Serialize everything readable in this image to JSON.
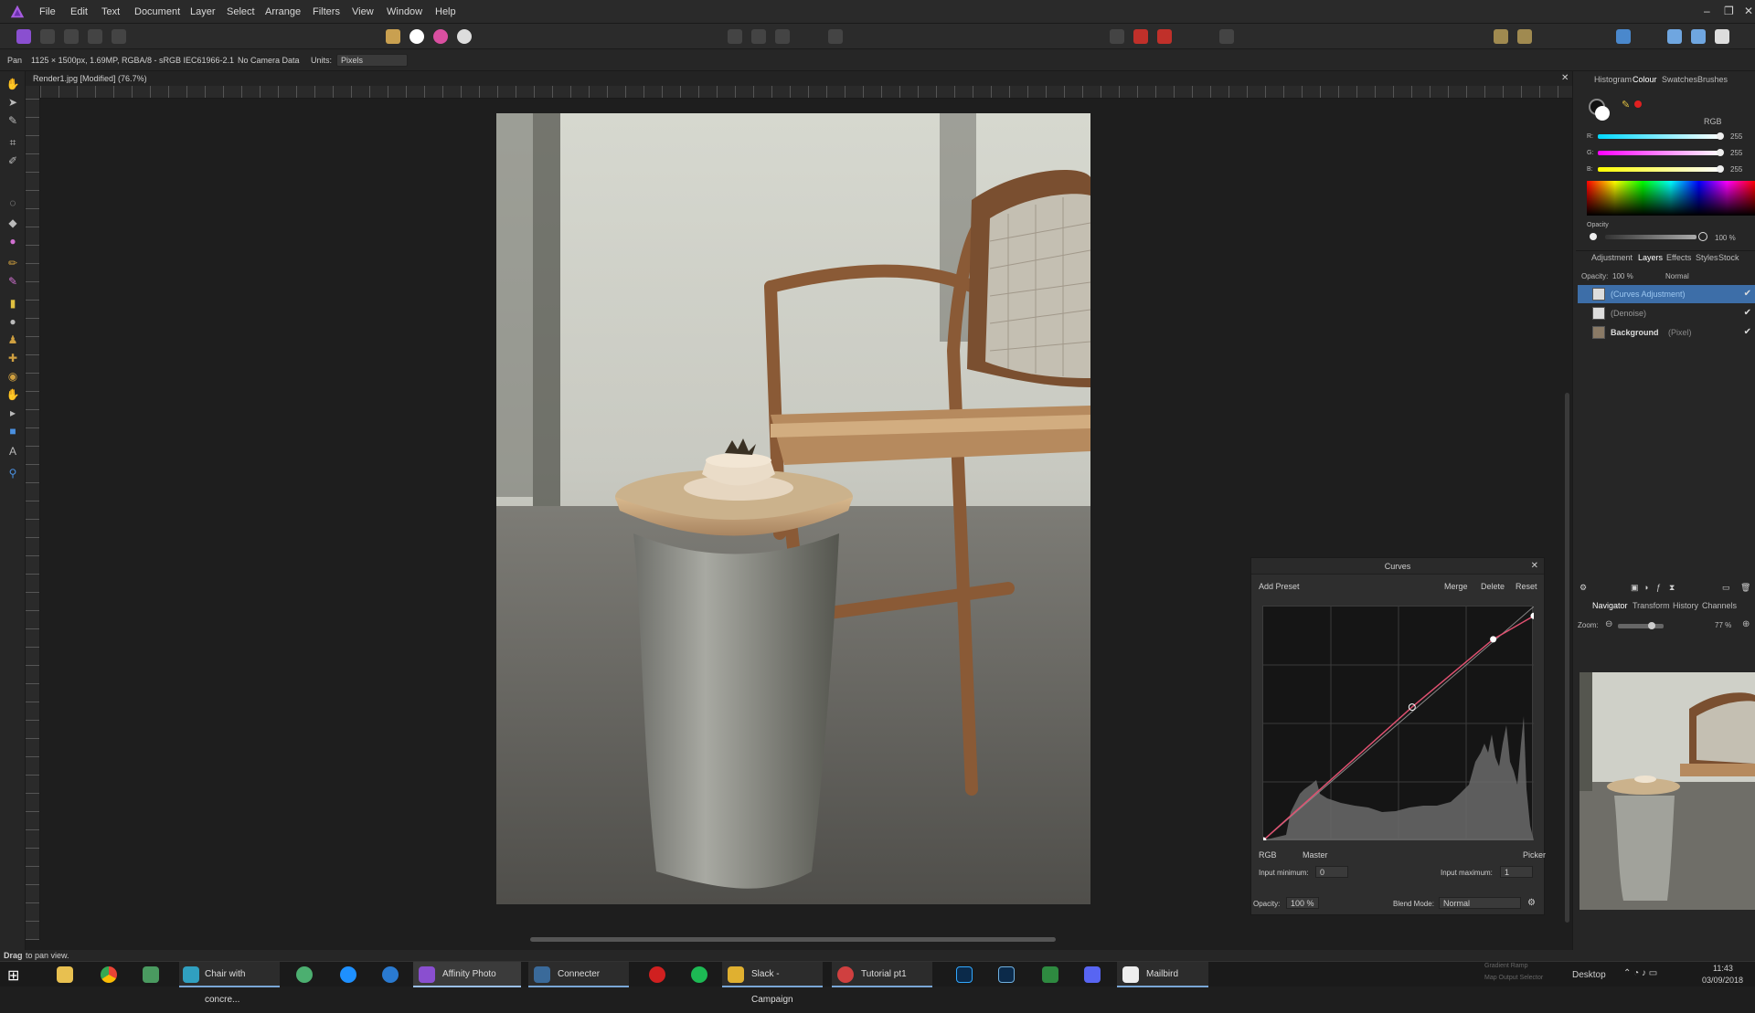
{
  "app": {
    "menu": [
      "File",
      "Edit",
      "Text",
      "Document",
      "Layer",
      "Select",
      "Arrange",
      "Filters",
      "View",
      "Window",
      "Help"
    ],
    "window_controls": [
      "–",
      "❐",
      "✕"
    ]
  },
  "context_bar": {
    "tool": "Pan",
    "image_info": "1125 × 1500px, 1.69MP, RGBA/8 - sRGB IEC61966-2.1",
    "camera": "No Camera Data",
    "units_label": "Units:",
    "units_value": "Pixels"
  },
  "document": {
    "tab_title": "Render1.jpg [Modified] (76.7%)"
  },
  "color_panel": {
    "tabs": [
      "Histogram",
      "Colour",
      "Swatches",
      "Brushes"
    ],
    "active_tab": "Colour",
    "model": "RGB",
    "r_label": "R:",
    "r_value": "255",
    "g_label": "G:",
    "g_value": "255",
    "b_label": "B:",
    "b_value": "255",
    "opacity_label": "Opacity",
    "opacity_value": "100 %"
  },
  "layers_panel": {
    "tabs": [
      "Adjustment",
      "Layers",
      "Effects",
      "Styles",
      "Stock"
    ],
    "active_tab": "Layers",
    "opacity_label": "Opacity:",
    "opacity_value": "100 %",
    "blend": "Normal",
    "layers": [
      {
        "name": "(Curves Adjustment)",
        "selected": true
      },
      {
        "name": "(Denoise)",
        "selected": false
      },
      {
        "name": "Background",
        "suffix": "(Pixel)",
        "selected": false
      }
    ]
  },
  "navigator_panel": {
    "tabs": [
      "Navigator",
      "Transform",
      "History",
      "Channels"
    ],
    "active_tab": "Navigator",
    "zoom_label": "Zoom:",
    "zoom_value": "77 %"
  },
  "curves": {
    "title": "Curves",
    "add_preset": "Add Preset",
    "merge": "Merge",
    "delete": "Delete",
    "reset": "Reset",
    "model": "RGB",
    "channel": "Master",
    "picker": "Picker",
    "input_min_label": "Input minimum:",
    "input_min_value": "0",
    "input_max_label": "Input maximum:",
    "input_max_value": "1",
    "opacity_label": "Opacity:",
    "opacity_value": "100 %",
    "blend_label": "Blend Mode:",
    "blend_value": "Normal",
    "control_points": [
      [
        0,
        0
      ],
      [
        0.55,
        0.57
      ],
      [
        0.85,
        0.86
      ],
      [
        1,
        0.96
      ]
    ]
  },
  "status": {
    "hint_bold": "Drag",
    "hint_rest": "to pan view."
  },
  "taskbar": {
    "items": [
      "Chair with concre...",
      "Affinity Photo",
      "Connecter",
      "Slack - Campaign",
      "Tutorial pt1",
      "Mailbird"
    ],
    "tray_label": "Desktop",
    "tray_small_1": "Gradient Ramp",
    "tray_small_2": "Map Output Selector",
    "time": "11:43",
    "date": "03/09/2018"
  }
}
